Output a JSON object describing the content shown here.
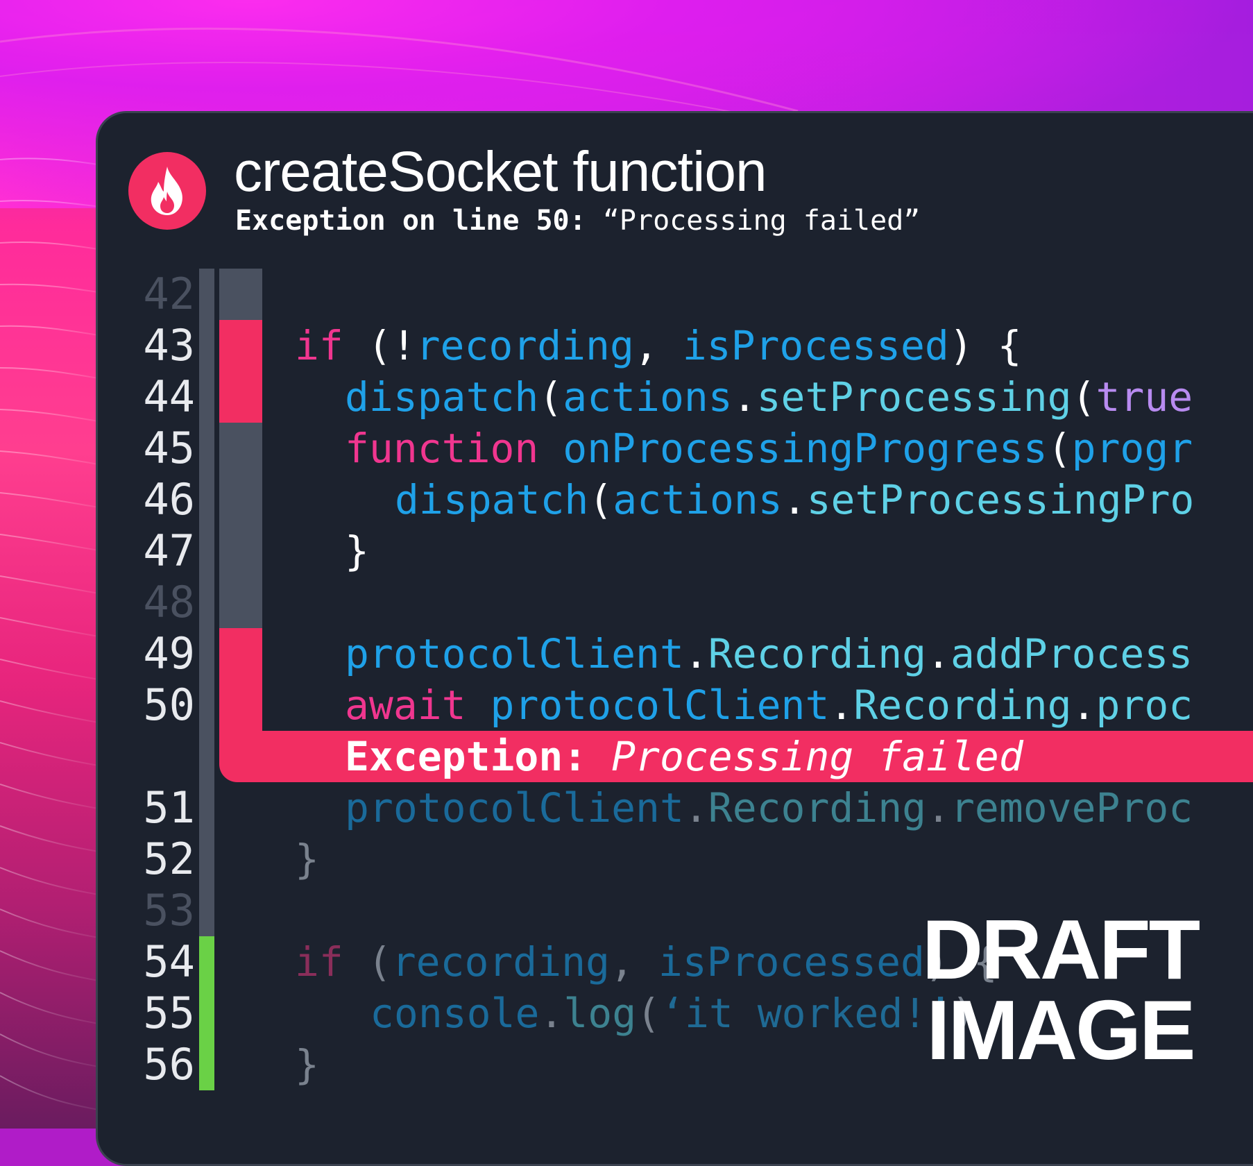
{
  "window": {
    "title": "createSocket function",
    "subtitle_label": "Exception on line 50:",
    "subtitle_message": "“Processing failed”",
    "logo_icon": "flame-icon"
  },
  "colors": {
    "accent": "#f22e62",
    "success": "#6ad146",
    "editor_bg": "#1c222e",
    "gutter": "#4a5160"
  },
  "line_numbers": [
    "42",
    "43",
    "44",
    "45",
    "46",
    "47",
    "48",
    "49",
    "50",
    "51",
    "52",
    "53",
    "54",
    "55",
    "56"
  ],
  "code": {
    "l43": {
      "kw": "if",
      "open": " (!",
      "a": "recording",
      "comma": ", ",
      "b": "isProcessed",
      "close": ") {"
    },
    "l44": {
      "a": "dispatch",
      "p1": "(",
      "b": "actions",
      "dot": ".",
      "c": "setProcessing",
      "p2": "(",
      "d": "true"
    },
    "l45": {
      "kw": "function",
      "sp": " ",
      "a": "onProcessingProgress",
      "p": "(",
      "b": "progr"
    },
    "l46": {
      "a": "dispatch",
      "p1": "(",
      "b": "actions",
      "dot": ".",
      "c": "setProcessingPro"
    },
    "l47": {
      "brace": "}"
    },
    "l49": {
      "a": "protocolClient",
      "d1": ".",
      "b": "Recording",
      "d2": ".",
      "c": "addProcess"
    },
    "l50": {
      "kw": "await",
      "sp": " ",
      "a": "protocolClient",
      "d1": ".",
      "b": "Recording",
      "d2": ".",
      "c": "proc"
    },
    "l51": {
      "a": "protocolClient",
      "d1": ".",
      "b": "Recording",
      "d2": ".",
      "c": "removeProc"
    },
    "l52": {
      "brace": "}"
    },
    "l54": {
      "kw": "if",
      "open": " (",
      "a": "recording",
      "comma": ", ",
      "b": "isProcessed",
      "close": ") {"
    },
    "l55": {
      "a": "console",
      "d": ".",
      "b": "log",
      "p": "(",
      "s": "‘it worked!’",
      "c": ")"
    },
    "l56": {
      "brace": "}"
    }
  },
  "exception": {
    "label": "Exception:",
    "message": "Processing failed"
  },
  "watermark": {
    "line1": "DRAFT",
    "line2": "IMAGE"
  }
}
